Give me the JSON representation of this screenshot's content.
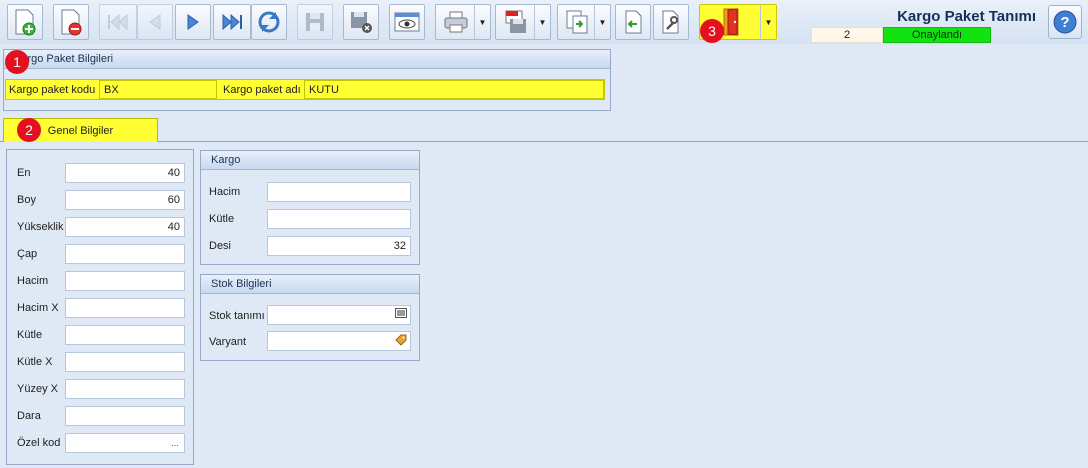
{
  "toolbar": {
    "buttons": [
      {
        "name": "new-record-icon"
      },
      {
        "name": "delete-record-icon"
      },
      {
        "name": "first-record-icon"
      },
      {
        "name": "previous-record-icon"
      },
      {
        "name": "next-record-icon"
      },
      {
        "name": "last-record-icon"
      },
      {
        "name": "refresh-icon"
      },
      {
        "name": "save-icon"
      },
      {
        "name": "save-close-icon"
      },
      {
        "name": "preview-icon"
      },
      {
        "name": "print-icon"
      },
      {
        "name": "pdf-export-icon"
      },
      {
        "name": "copy-export-icon"
      },
      {
        "name": "import-icon"
      },
      {
        "name": "tools-icon"
      },
      {
        "name": "exit-door-icon"
      }
    ]
  },
  "header": {
    "title": "Kargo Paket Tanımı",
    "record_number": "2",
    "status": "Onaylandı"
  },
  "cargo_panel": {
    "title": "Kargo Paket Bilgileri",
    "code_label": "Kargo paket kodu",
    "code_value": "BX",
    "name_label": "Kargo paket adı",
    "name_value": "KUTU"
  },
  "tabs": [
    {
      "label": "Genel Bilgiler",
      "active": true
    }
  ],
  "general": {
    "fields": [
      {
        "label": "En",
        "value": "40"
      },
      {
        "label": "Boy",
        "value": "60"
      },
      {
        "label": "Yükseklik",
        "value": "40"
      },
      {
        "label": "Çap",
        "value": ""
      },
      {
        "label": "Hacim",
        "value": ""
      },
      {
        "label": "Hacim X",
        "value": ""
      },
      {
        "label": "Kütle",
        "value": ""
      },
      {
        "label": "Kütle X",
        "value": ""
      },
      {
        "label": "Yüzey X",
        "value": ""
      },
      {
        "label": "Dara",
        "value": ""
      },
      {
        "label": "Özel kod",
        "value": "",
        "button": "..."
      }
    ]
  },
  "kargo_group": {
    "title": "Kargo",
    "fields": [
      {
        "label": "Hacim",
        "value": ""
      },
      {
        "label": "Kütle",
        "value": ""
      },
      {
        "label": "Desi",
        "value": "32"
      }
    ]
  },
  "stock_group": {
    "title": "Stok Bilgileri",
    "fields": [
      {
        "label": "Stok tanımı",
        "value": ""
      },
      {
        "label": "Varyant",
        "value": ""
      }
    ]
  },
  "callouts": [
    "1",
    "2",
    "3"
  ],
  "colors": {
    "highlight": "#ffff33",
    "status_green": "#12e112",
    "callout_red": "#e3111f",
    "title_blue": "#15315a"
  }
}
